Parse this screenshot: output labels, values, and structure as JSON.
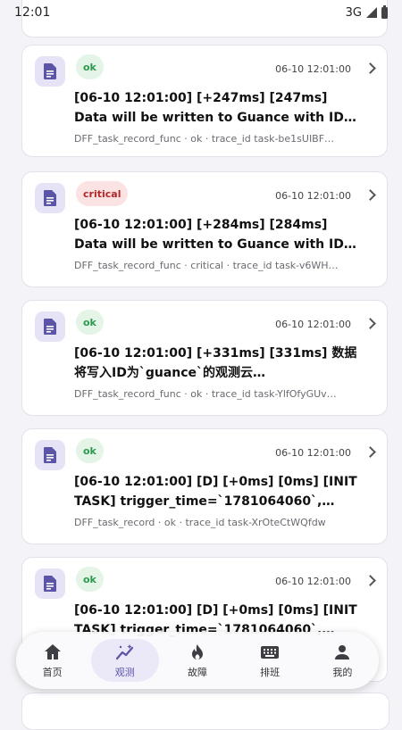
{
  "status_bar": {
    "time": "12:01",
    "network": "3G"
  },
  "records": [
    {
      "status": "ok",
      "time": "06-10 12:01:00",
      "title": "[06-10 12:01:00] [+247ms] [247ms] Data will be written to Guance with ID `guance`…",
      "meta": "DFF_task_record_func · ok · trace_id task-be1sUIBF…"
    },
    {
      "status": "critical",
      "time": "06-10 12:01:00",
      "title": "[06-10 12:01:00] [+284ms] [284ms] Data will be written to Guance with ID `guance`…",
      "meta": "DFF_task_record_func · critical · trace_id task-v6WH…"
    },
    {
      "status": "ok",
      "time": "06-10 12:01:00",
      "title": "[06-10 12:01:00] [+331ms] [331ms] 数据将写入ID为`guance`的观测云…",
      "meta": "DFF_task_record_func · ok · trace_id task-YlfOfyGUv…"
    },
    {
      "status": "ok",
      "time": "06-10 12:01:00",
      "title": "[06-10 12:01:00] [D] [+0ms] [0ms] [INIT TASK] trigger_time=`1781064060`, eta=`…",
      "meta": "DFF_task_record · ok · trace_id task-XrOteCtWQfdw"
    },
    {
      "status": "ok",
      "time": "06-10 12:01:00",
      "title": "[06-10 12:01:00] [D] [+0ms] [0ms] [INIT TASK] trigger_time=`1781064060`, eta=`…",
      "meta": ""
    }
  ],
  "nav": [
    {
      "label": "首页",
      "icon": "home-icon"
    },
    {
      "label": "观测",
      "icon": "insights-icon",
      "active": true
    },
    {
      "label": "故障",
      "icon": "fire-icon"
    },
    {
      "label": "排班",
      "icon": "keyboard-icon"
    },
    {
      "label": "我的",
      "icon": "person-icon"
    }
  ],
  "colors": {
    "accent": "#5b55a8",
    "ok_bg": "#e4f5e8",
    "ok_fg": "#2e9a4f",
    "critical_bg": "#fbe3e3",
    "critical_fg": "#b32929"
  }
}
